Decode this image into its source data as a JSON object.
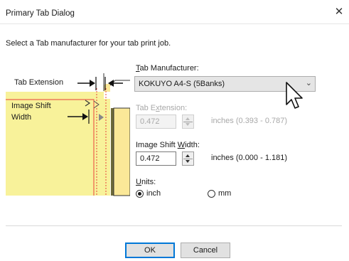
{
  "window": {
    "title": "Primary Tab Dialog",
    "close_glyph": "✕"
  },
  "instruction": "Select a Tab manufacturer for your tab print job.",
  "illustration": {
    "tab_extension_label": "Tab Extension",
    "image_shift_label_1": "Image Shift",
    "image_shift_label_2": "Width"
  },
  "manufacturer": {
    "label_ul": "T",
    "label_rest": "ab Manufacturer:",
    "value": "KOKUYO A4-S (5Banks)"
  },
  "tab_extension": {
    "label_pre": "Tab E",
    "label_ul": "x",
    "label_post": "tension:",
    "value": "0.472",
    "range": "inches (0.393 - 0.787)"
  },
  "image_shift": {
    "label_pre": "Image Shift ",
    "label_ul": "W",
    "label_post": "idth:",
    "value": "0.472",
    "range": "inches (0.000 - 1.181)"
  },
  "units": {
    "label_ul": "U",
    "label_post": "nits:",
    "options": [
      {
        "label": "inch",
        "selected": true
      },
      {
        "label": "mm",
        "selected": false
      }
    ]
  },
  "buttons": {
    "ok": "OK",
    "cancel": "Cancel"
  },
  "colors": {
    "paper": "#f8f29a",
    "tab": "#fbe898",
    "guide_red": "#e8423a",
    "accent": "#0078d7"
  }
}
